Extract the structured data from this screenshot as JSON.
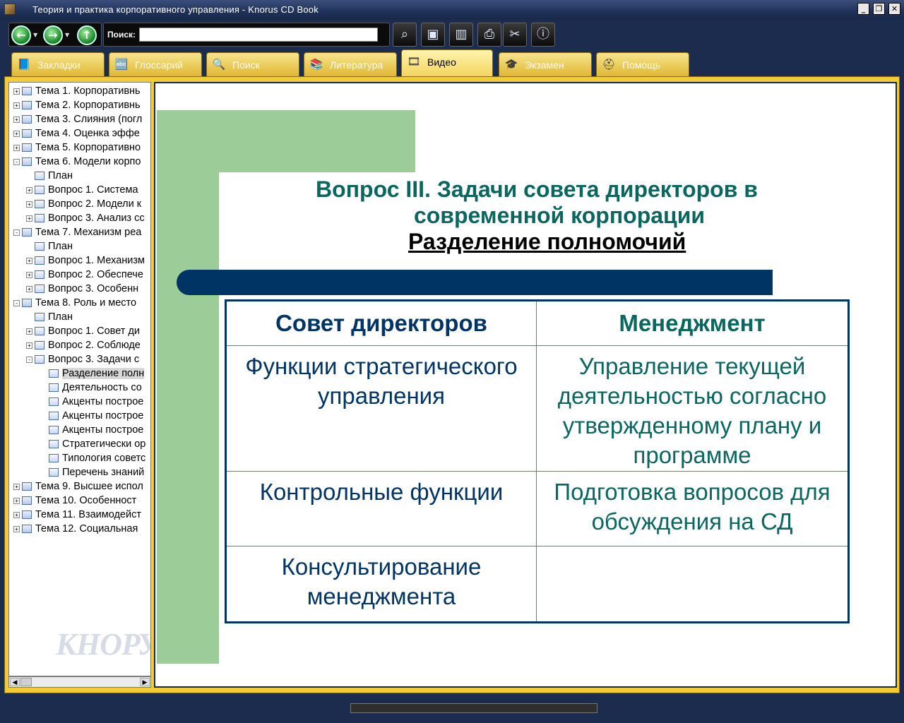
{
  "window": {
    "title": "Теория и практика корпоративного управления - Knorus CD Book",
    "buttons": [
      "_",
      "❐",
      "✕"
    ]
  },
  "toolbar": {
    "back_icon": "arrow-left-icon",
    "forward_icon": "arrow-right-icon",
    "up_icon": "arrow-up-icon",
    "search_label": "Поиск:",
    "search_value": "",
    "tools": [
      "magnifier-icon",
      "screen-icon",
      "book-icon",
      "printer-icon",
      "tools-icon",
      "info-icon"
    ]
  },
  "tabs": [
    {
      "label": "Закладки",
      "icon": "📘",
      "active": false
    },
    {
      "label": "Глоссарий",
      "icon": "🔤",
      "active": false
    },
    {
      "label": "Поиск",
      "icon": "🔍",
      "active": false
    },
    {
      "label": "Литература",
      "icon": "📚",
      "active": false
    },
    {
      "label": "Видео",
      "icon": "🎞",
      "active": true
    },
    {
      "label": "Экзамен",
      "icon": "🎓",
      "active": false
    },
    {
      "label": "Помощь",
      "icon": "⛑",
      "active": false
    }
  ],
  "tree": {
    "items": [
      {
        "label": "Тема 1. Корпоративнь",
        "level": 0,
        "exp": "+"
      },
      {
        "label": "Тема 2. Корпоративнь",
        "level": 0,
        "exp": "+"
      },
      {
        "label": "Тема 3. Слияния (погл",
        "level": 0,
        "exp": "+"
      },
      {
        "label": "Тема 4. Оценка эффе",
        "level": 0,
        "exp": "+"
      },
      {
        "label": "Тема 5. Корпоративно",
        "level": 0,
        "exp": "+"
      },
      {
        "label": "Тема 6. Модели корпо",
        "level": 0,
        "exp": "-"
      },
      {
        "label": "План",
        "level": 1,
        "exp": ""
      },
      {
        "label": "Вопрос 1. Система",
        "level": 1,
        "exp": "+"
      },
      {
        "label": "Вопрос 2. Модели к",
        "level": 1,
        "exp": "+"
      },
      {
        "label": "Вопрос 3. Анализ сс",
        "level": 1,
        "exp": "+"
      },
      {
        "label": "Тема 7. Механизм реа",
        "level": 0,
        "exp": "-"
      },
      {
        "label": "План",
        "level": 1,
        "exp": ""
      },
      {
        "label": "Вопрос 1. Механизм",
        "level": 1,
        "exp": "+"
      },
      {
        "label": "Вопрос 2. Обеспече",
        "level": 1,
        "exp": "+"
      },
      {
        "label": "Вопрос 3. Особенн",
        "level": 1,
        "exp": "+"
      },
      {
        "label": "Тема 8. Роль и место",
        "level": 0,
        "exp": "-"
      },
      {
        "label": "План",
        "level": 1,
        "exp": ""
      },
      {
        "label": "Вопрос 1. Совет ди",
        "level": 1,
        "exp": "+"
      },
      {
        "label": "Вопрос 2. Соблюде",
        "level": 1,
        "exp": "+"
      },
      {
        "label": "Вопрос 3. Задачи с",
        "level": 1,
        "exp": "-"
      },
      {
        "label": "Разделение полн",
        "level": 2,
        "exp": "",
        "selected": true
      },
      {
        "label": "Деятельность со",
        "level": 2,
        "exp": ""
      },
      {
        "label": "Акценты построе",
        "level": 2,
        "exp": ""
      },
      {
        "label": "Акценты построе",
        "level": 2,
        "exp": ""
      },
      {
        "label": "Акценты построе",
        "level": 2,
        "exp": ""
      },
      {
        "label": "Стратегически ор",
        "level": 2,
        "exp": ""
      },
      {
        "label": "Типология советс",
        "level": 2,
        "exp": ""
      },
      {
        "label": "Перечень знаний",
        "level": 2,
        "exp": ""
      },
      {
        "label": "Тема 9. Высшее испол",
        "level": 0,
        "exp": "+"
      },
      {
        "label": "Тема 10. Особенност",
        "level": 0,
        "exp": "+"
      },
      {
        "label": "Тема 11. Взаимодейст",
        "level": 0,
        "exp": "+"
      },
      {
        "label": "Тема 12. Социальная",
        "level": 0,
        "exp": "+"
      }
    ],
    "watermark": "КНОРУС"
  },
  "slide": {
    "title_line1": "Вопрос III. Задачи совета директоров в",
    "title_line2": "современной корпорации",
    "subtitle": "Разделение полномочий",
    "headers": [
      "Совет директоров",
      "Менеджмент"
    ],
    "rows": [
      [
        "Функции стратегического управления",
        "Управление текущей деятельностью согласно утвержденному плану и программе"
      ],
      [
        "Контрольные функции",
        "Подготовка вопросов для обсуждения на СД"
      ],
      [
        "Консультирование менеджмента",
        ""
      ]
    ],
    "colors": {
      "teal": "#0b6660",
      "navy": "#003464",
      "green": "#9ccc98"
    }
  }
}
